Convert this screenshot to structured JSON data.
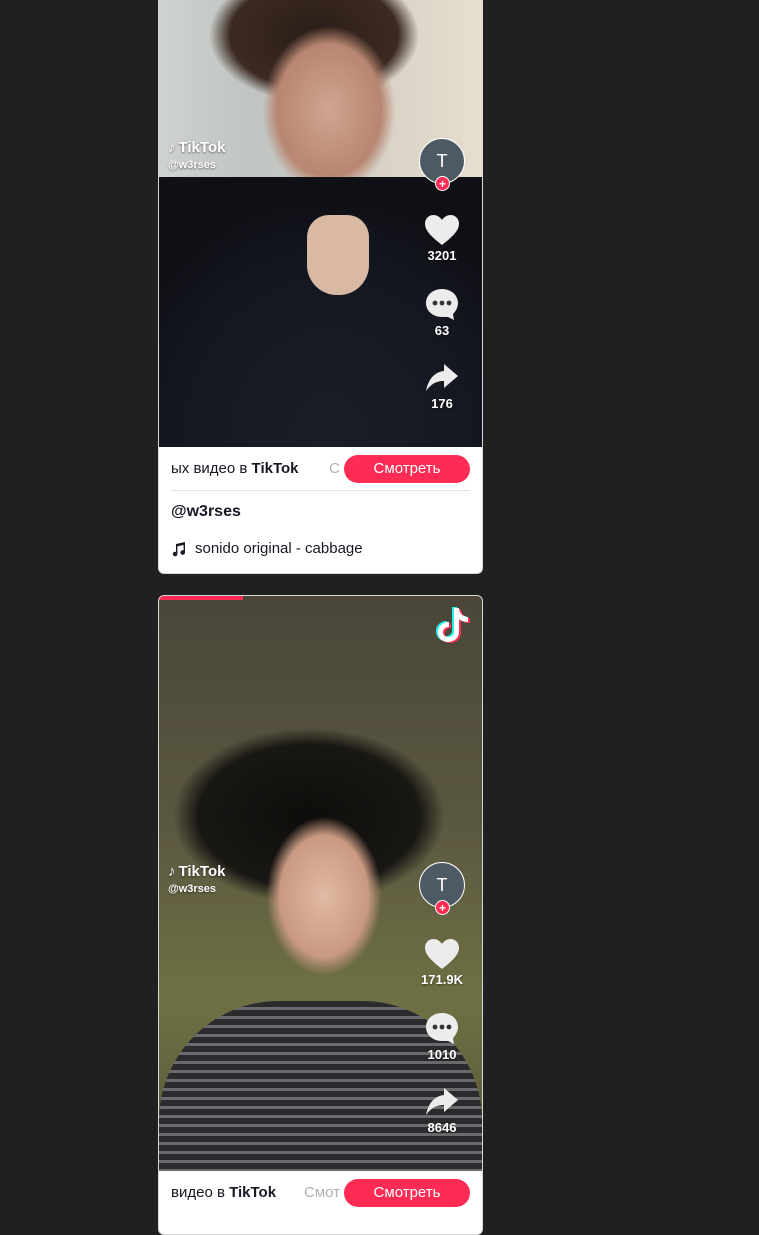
{
  "posts": [
    {
      "brand": "TikTok",
      "handle": "@w3rses",
      "avatar_letter": "T",
      "likes": "3201",
      "comments": "63",
      "shares": "176",
      "bar_text_prefix": "ых видео в ",
      "bar_text_brand": "TikTok",
      "bar_ghost": "С",
      "watch_label": "Смотреть",
      "author": "@w3rses",
      "music": "sonido original - cabbage"
    },
    {
      "brand": "TikTok",
      "handle": "@w3rses",
      "avatar_letter": "T",
      "likes": "171.9K",
      "comments": "1010",
      "shares": "8646",
      "bar_text_prefix": "видео в ",
      "bar_text_brand": "TikTok",
      "bar_ghost": "Смот",
      "watch_label": "Смотреть",
      "progress": 0.26
    }
  ],
  "icons": {
    "note": "tiktok-note-icon",
    "heart": "heart-icon",
    "comment": "comment-icon",
    "share": "share-icon",
    "music": "music-note-icon"
  },
  "colors": {
    "accent": "#fe2c55",
    "background": "#202020"
  }
}
